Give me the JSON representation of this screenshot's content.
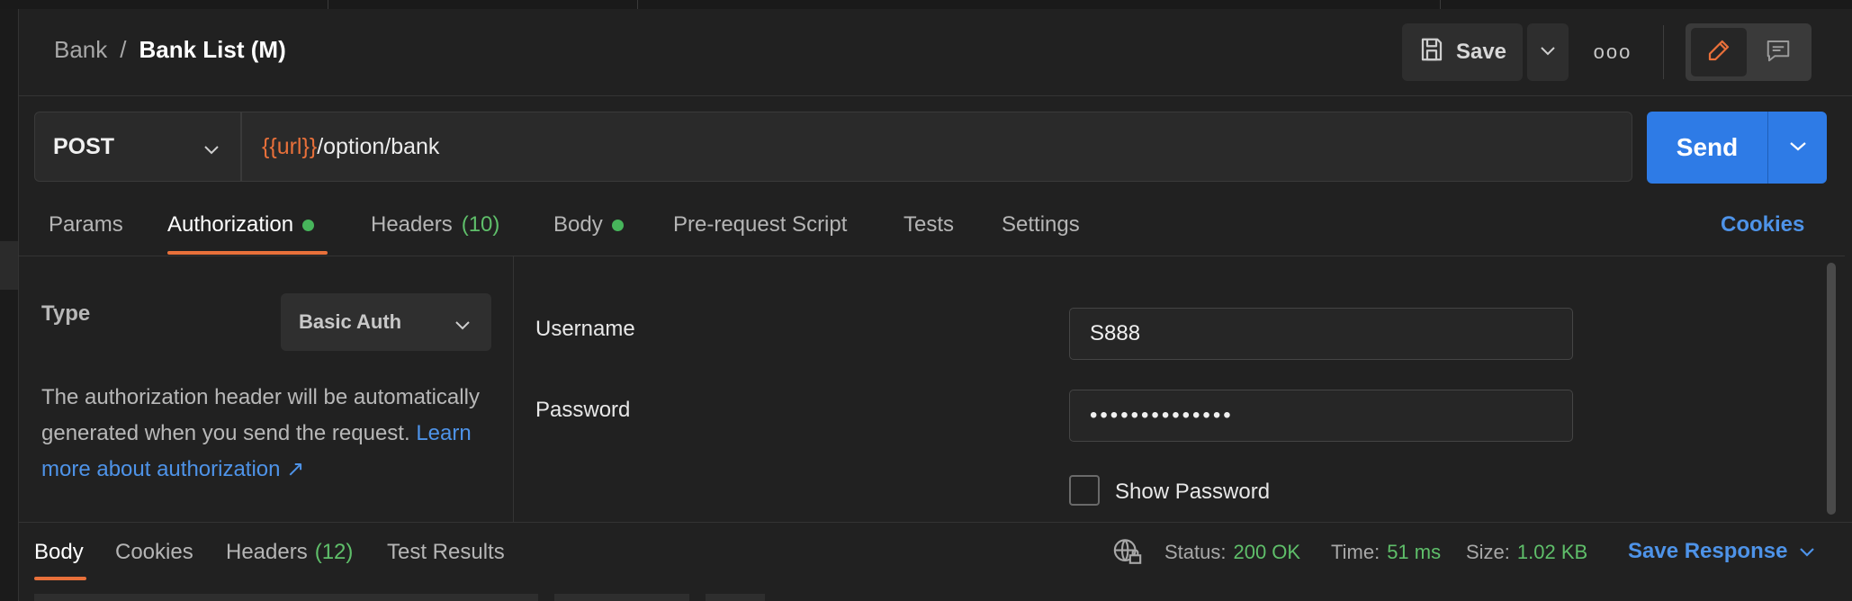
{
  "breadcrumb": {
    "parent": "Bank",
    "separator": "/",
    "current": "Bank List (M)"
  },
  "toolbar": {
    "save_label": "Save",
    "more_label": "ooo"
  },
  "request": {
    "method": "POST",
    "url_variable": "{{url}}",
    "url_path": "/option/bank",
    "send_label": "Send"
  },
  "tabs": {
    "params": "Params",
    "authorization": "Authorization",
    "headers": "Headers",
    "headers_count": "(10)",
    "body": "Body",
    "prerequest": "Pre-request Script",
    "tests": "Tests",
    "settings": "Settings",
    "cookies": "Cookies"
  },
  "auth": {
    "type_label": "Type",
    "type_value": "Basic Auth",
    "description": "The authorization header will be automatically generated when you send the request.",
    "learn_more": "Learn more about authorization ↗",
    "username_label": "Username",
    "username_value": "S888",
    "password_label": "Password",
    "password_value": "••••••••••••••",
    "show_password_label": "Show Password"
  },
  "response": {
    "tabs": {
      "body": "Body",
      "cookies": "Cookies",
      "headers": "Headers",
      "headers_count": "(12)",
      "test_results": "Test Results"
    },
    "status_label": "Status:",
    "status_value": "200 OK",
    "time_label": "Time:",
    "time_value": "51 ms",
    "size_label": "Size:",
    "size_value": "1.02 KB",
    "save_response": "Save Response"
  },
  "colors": {
    "accent_orange": "#e8703a",
    "link_blue": "#4e93e8",
    "send_blue": "#2e7be6",
    "success_green": "#5fbf6a"
  }
}
